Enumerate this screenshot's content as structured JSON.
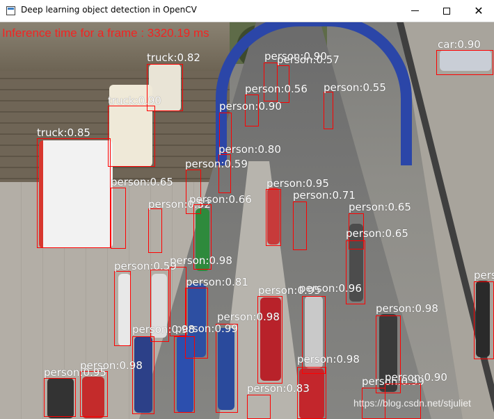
{
  "window": {
    "title": "Deep learning object detection in OpenCV",
    "controls": {
      "minimize": "minimize",
      "maximize": "maximize",
      "close": "close"
    }
  },
  "overlay": {
    "inference_text": "Inference time for a frame : 3320.19 ms",
    "watermark": "https://blog.csdn.net/stjuliet",
    "box_color": "#ff0000",
    "text_color": "#ff1a1a"
  },
  "detections": [
    {
      "label": "truck:0.82"
    },
    {
      "label": "truck:0.90"
    },
    {
      "label": "truck:0.85"
    },
    {
      "label": "car:0.90"
    },
    {
      "label": "person:0.90"
    },
    {
      "label": "person:0.57"
    },
    {
      "label": "person:0.56"
    },
    {
      "label": "person:0.55"
    },
    {
      "label": "person:0.90"
    },
    {
      "label": "person:0.80"
    },
    {
      "label": "person:0.59"
    },
    {
      "label": "person:0.65"
    },
    {
      "label": "person:0.95"
    },
    {
      "label": "person:0.71"
    },
    {
      "label": "person:0.52"
    },
    {
      "label": "person:0.66"
    },
    {
      "label": "person:0.65"
    },
    {
      "label": "person:0.65"
    },
    {
      "label": "person:0.98"
    },
    {
      "label": "person:0.59"
    },
    {
      "label": "person:0.81"
    },
    {
      "label": "person:0.95"
    },
    {
      "label": "person:0.96"
    },
    {
      "label": "person:0.98"
    },
    {
      "label": "person:0.98"
    },
    {
      "label": "person:0.99"
    },
    {
      "label": "person:0.98"
    },
    {
      "label": "person:0.98"
    },
    {
      "label": "person:0.95"
    },
    {
      "label": "person:0.98"
    },
    {
      "label": "person:0.83"
    },
    {
      "label": "person:0.99"
    },
    {
      "label": "person:0.90"
    },
    {
      "label": "pers"
    }
  ]
}
